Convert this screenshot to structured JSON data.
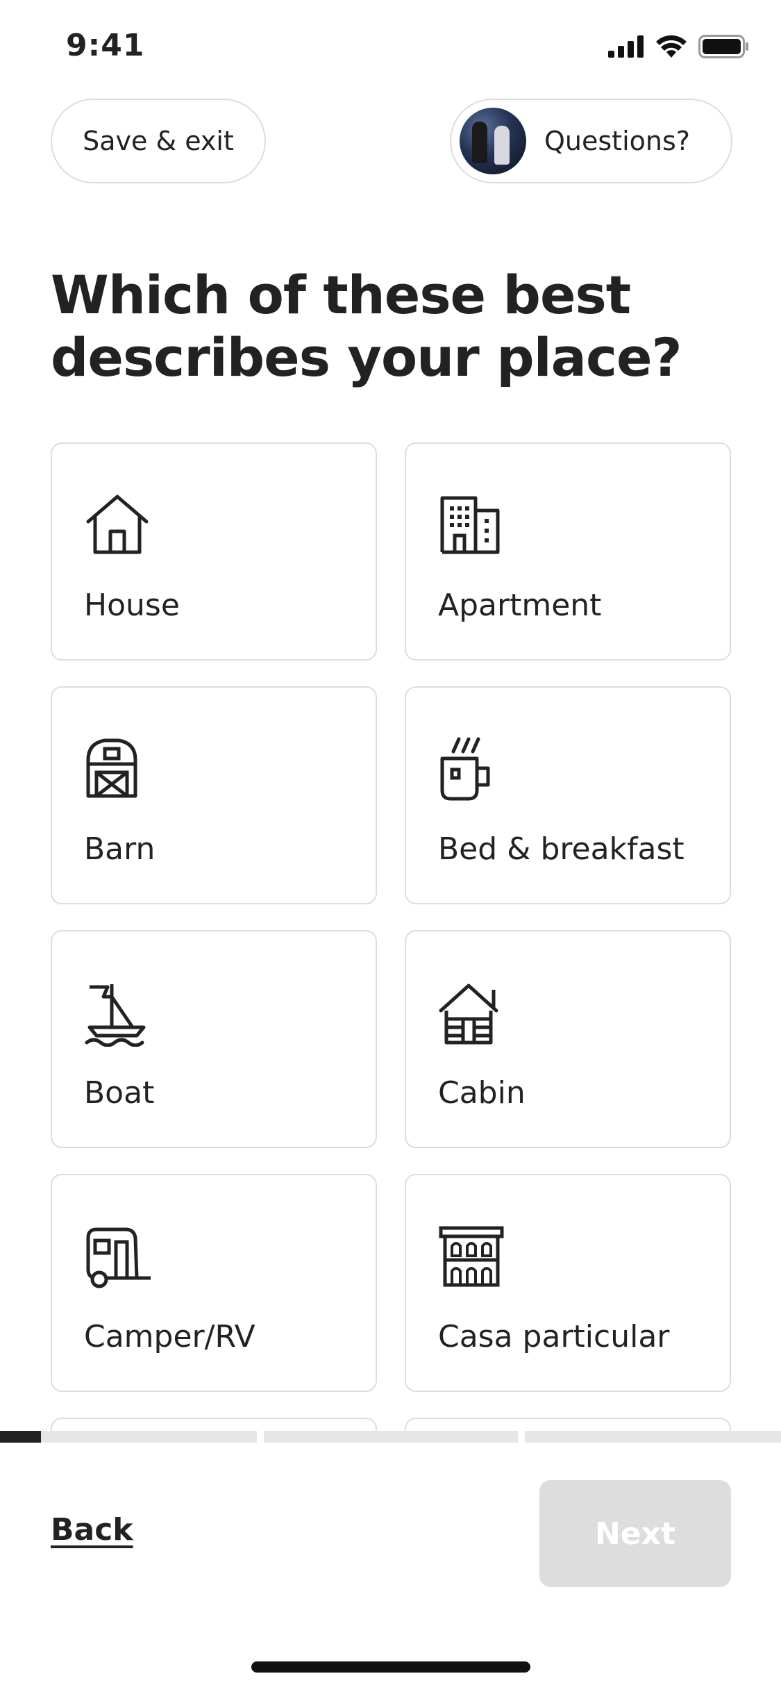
{
  "status_bar": {
    "time": "9:41",
    "icons": [
      "cellular-signal-icon",
      "wifi-icon",
      "battery-icon"
    ]
  },
  "header": {
    "save_exit_label": "Save & exit",
    "questions_label": "Questions?",
    "avatar_icon": "host-avatar"
  },
  "title": "Which of these best describes your place?",
  "property_types": [
    {
      "label": "House",
      "icon": "house-icon"
    },
    {
      "label": "Apartment",
      "icon": "apartment-building-icon"
    },
    {
      "label": "Barn",
      "icon": "barn-icon"
    },
    {
      "label": "Bed & breakfast",
      "icon": "coffee-mug-icon"
    },
    {
      "label": "Boat",
      "icon": "sailboat-icon"
    },
    {
      "label": "Cabin",
      "icon": "cabin-icon"
    },
    {
      "label": "Camper/RV",
      "icon": "camper-trailer-icon"
    },
    {
      "label": "Casa particular",
      "icon": "casa-particular-icon"
    }
  ],
  "progress": {
    "segments": 3,
    "current_segment": 1,
    "fill_fraction_of_first_segment": 0.16
  },
  "footer": {
    "back_label": "Back",
    "next_label": "Next",
    "next_enabled": false
  },
  "colors": {
    "text": "#222222",
    "border": "#dddddd",
    "progress_active": "#222222",
    "progress_track": "#e6e6e6",
    "next_disabled_bg": "#dddddd",
    "next_disabled_text": "#ffffff"
  }
}
